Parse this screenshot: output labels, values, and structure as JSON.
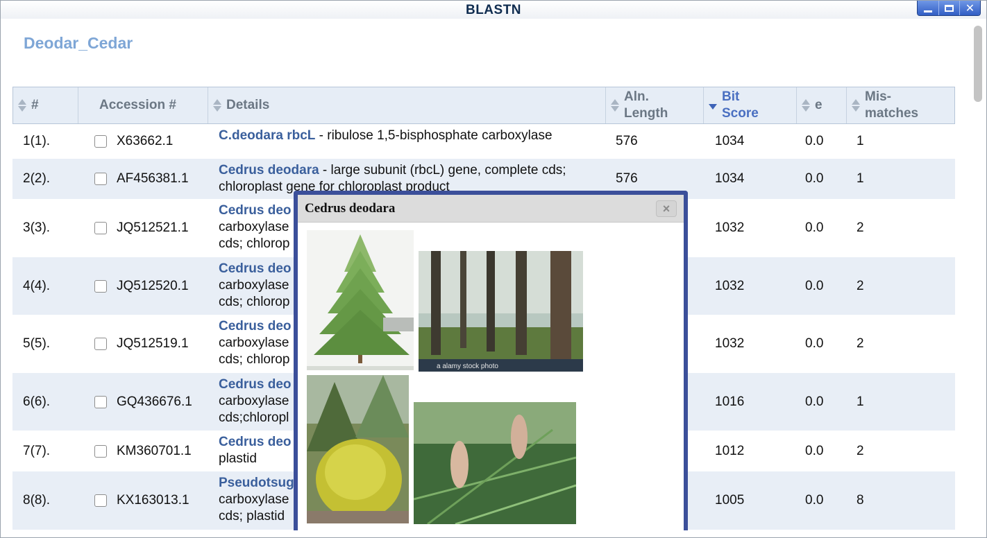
{
  "window": {
    "title": "BLASTN"
  },
  "page": {
    "title": "Deodar_Cedar"
  },
  "table": {
    "headers": {
      "num": "#",
      "accession": "Accession #",
      "details": "Details",
      "aln_length_1": "Aln.",
      "aln_length_2": "Length",
      "bit_score_1": "Bit",
      "bit_score_2": "Score",
      "e": "e",
      "mismatches_1": "Mis-",
      "mismatches_2": "matches"
    },
    "rows": [
      {
        "num": "1(1).",
        "accession": "X63662.1",
        "link": "C.deodara rbcL",
        "desc": " - ribulose 1,5-bisphosphate carboxylase",
        "desc2": "",
        "desc3": "",
        "aln": "576",
        "bit": "1034",
        "e": "0.0",
        "mm": "1"
      },
      {
        "num": "2(2).",
        "accession": "AF456381.1",
        "link": "Cedrus deodara",
        "desc": " - large subunit (rbcL) gene, complete cds;",
        "desc2": "chloroplast gene for chloroplast product",
        "desc3": "",
        "aln": "576",
        "bit": "1034",
        "e": "0.0",
        "mm": "1"
      },
      {
        "num": "3(3).",
        "accession": "JQ512521.1",
        "link": "Cedrus deo",
        "desc": "",
        "desc2": "carboxylase",
        "desc3": "cds; chlorop",
        "aln": "",
        "bit": "1032",
        "e": "0.0",
        "mm": "2"
      },
      {
        "num": "4(4).",
        "accession": "JQ512520.1",
        "link": "Cedrus deo",
        "desc": "",
        "desc2": "carboxylase",
        "desc3": "cds; chlorop",
        "aln": "",
        "bit": "1032",
        "e": "0.0",
        "mm": "2"
      },
      {
        "num": "5(5).",
        "accession": "JQ512519.1",
        "link": "Cedrus deo",
        "desc": "",
        "desc2": "carboxylase",
        "desc3": "cds; chlorop",
        "aln": "",
        "bit": "1032",
        "e": "0.0",
        "mm": "2"
      },
      {
        "num": "6(6).",
        "accession": "GQ436676.1",
        "link": "Cedrus deo",
        "desc": "",
        "desc2": "carboxylase",
        "desc3": "cds;chloropl",
        "aln": "",
        "bit": "1016",
        "e": "0.0",
        "mm": "1"
      },
      {
        "num": "7(7).",
        "accession": "KM360701.1",
        "link": "Cedrus deo",
        "desc": "",
        "desc2": "plastid",
        "desc3": "",
        "aln": "",
        "bit": "1012",
        "e": "0.0",
        "mm": "2"
      },
      {
        "num": "8(8).",
        "accession": "KX163013.1",
        "link": "Pseudotsug",
        "desc": "",
        "desc2": "carboxylase",
        "desc3": "cds; plastid",
        "aln": "",
        "bit": "1005",
        "e": "0.0",
        "mm": "8"
      }
    ]
  },
  "popup": {
    "title": "Cedrus deodara",
    "close": "×",
    "images": [
      {
        "name": "cedar-tree-illustration"
      },
      {
        "name": "cedar-forest-photo",
        "watermark": "a alamy stock photo"
      },
      {
        "name": "golden-cedar-shrub-photo"
      },
      {
        "name": "cedar-cones-photo"
      }
    ]
  }
}
